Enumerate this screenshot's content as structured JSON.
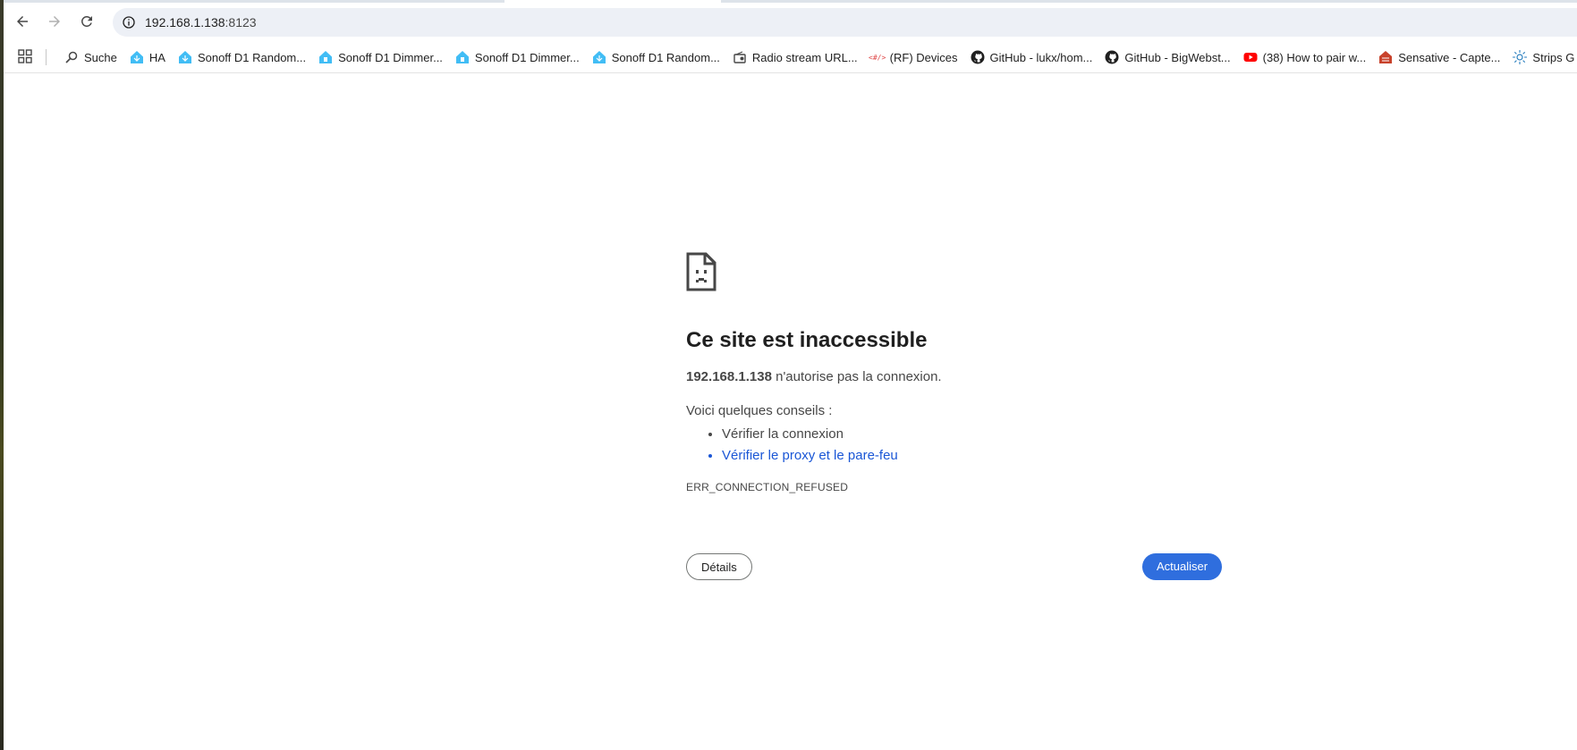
{
  "toolbar": {
    "url_host": "192.168.1.138",
    "url_port": ":8123"
  },
  "bookmarks": [
    {
      "label": "Suche",
      "icon": "search-icon"
    },
    {
      "label": "HA",
      "icon": "home-assistant-icon"
    },
    {
      "label": "Sonoff D1 Random...",
      "icon": "home-assistant-icon"
    },
    {
      "label": "Sonoff D1 Dimmer...",
      "icon": "house-icon"
    },
    {
      "label": "Sonoff D1 Dimmer...",
      "icon": "house-icon"
    },
    {
      "label": "Sonoff D1 Random...",
      "icon": "home-assistant-icon"
    },
    {
      "label": "Radio stream URL...",
      "icon": "radio-icon"
    },
    {
      "label": "(RF) Devices",
      "icon": "code-icon"
    },
    {
      "label": "GitHub - lukx/hom...",
      "icon": "github-icon"
    },
    {
      "label": "GitHub - BigWebst...",
      "icon": "github-icon"
    },
    {
      "label": "(38) How to pair w...",
      "icon": "youtube-icon"
    },
    {
      "label": "Sensative - Capte...",
      "icon": "sensative-icon"
    },
    {
      "label": "Strips G",
      "icon": "sun-icon"
    }
  ],
  "error": {
    "title": "Ce site est inaccessible",
    "host": "192.168.1.138",
    "description": " n'autorise pas la connexion.",
    "tips_intro": "Voici quelques conseils :",
    "tips": [
      "Vérifier la connexion",
      "Vérifier le proxy et le pare-feu"
    ],
    "code": "ERR_CONNECTION_REFUSED",
    "details_label": "Détails",
    "reload_label": "Actualiser"
  },
  "colors": {
    "accent": "#2f6ede",
    "link": "#1a56d6",
    "omnibox": "#edf0f6"
  }
}
